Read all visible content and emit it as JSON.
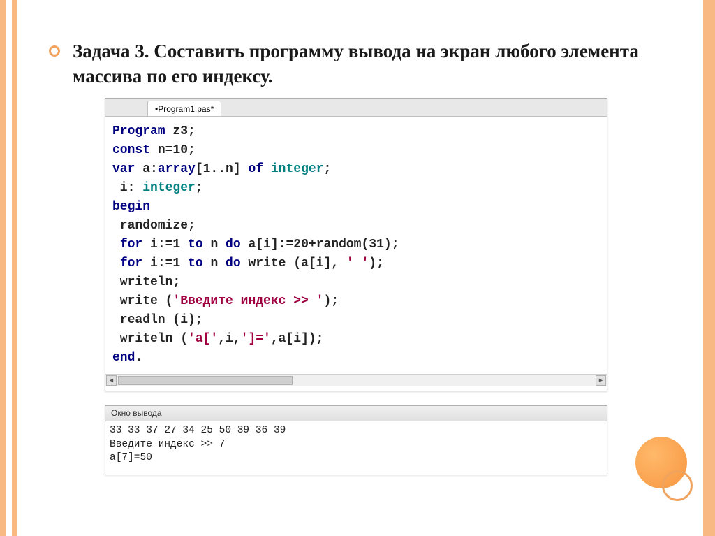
{
  "title": "Задача 3. Составить программу вывода на экран любого элемента массива по его индексу.",
  "tab": {
    "label": "•Program1.pas*"
  },
  "code": {
    "l1_kw1": "Program",
    "l1_rest": " z3;",
    "l2_kw1": "const",
    "l2_rest": " n=10;",
    "l3_kw1": "var",
    "l3_mid1": " a:",
    "l3_kw2": "array",
    "l3_mid2": "[1..n] ",
    "l3_kw3": "of",
    "l3_sp": " ",
    "l3_ty": "integer",
    "l3_end": ";",
    "l4_pre": " i: ",
    "l4_ty": "integer",
    "l4_end": ";",
    "l5_kw": "begin",
    "l6": " randomize;",
    "l7_pre": " ",
    "l7_kw1": "for",
    "l7_a": " i:=1 ",
    "l7_kw2": "to",
    "l7_b": " n ",
    "l7_kw3": "do",
    "l7_c": " a[i]:=20+random(31);",
    "l8_pre": " ",
    "l8_kw1": "for",
    "l8_a": " i:=1 ",
    "l8_kw2": "to",
    "l8_b": " n ",
    "l8_kw3": "do",
    "l8_c": " write (a[i], ",
    "l8_str": "' '",
    "l8_d": ");",
    "l9": " writeln;",
    "l10_a": " write (",
    "l10_str": "'Введите индекс >> '",
    "l10_b": ");",
    "l11": " readln (i);",
    "l12_a": " writeln (",
    "l12_s1": "'a['",
    "l12_b": ",i,",
    "l12_s2": "']='",
    "l12_c": ",a[i]);",
    "l13_kw": "end",
    "l13_dot": "."
  },
  "output": {
    "panel_title": "Окно вывода",
    "line1": "33 33 37 27 34 25 50 39 36 39",
    "line2": "Введите индекс >> 7",
    "line3": "a[7]=50"
  }
}
